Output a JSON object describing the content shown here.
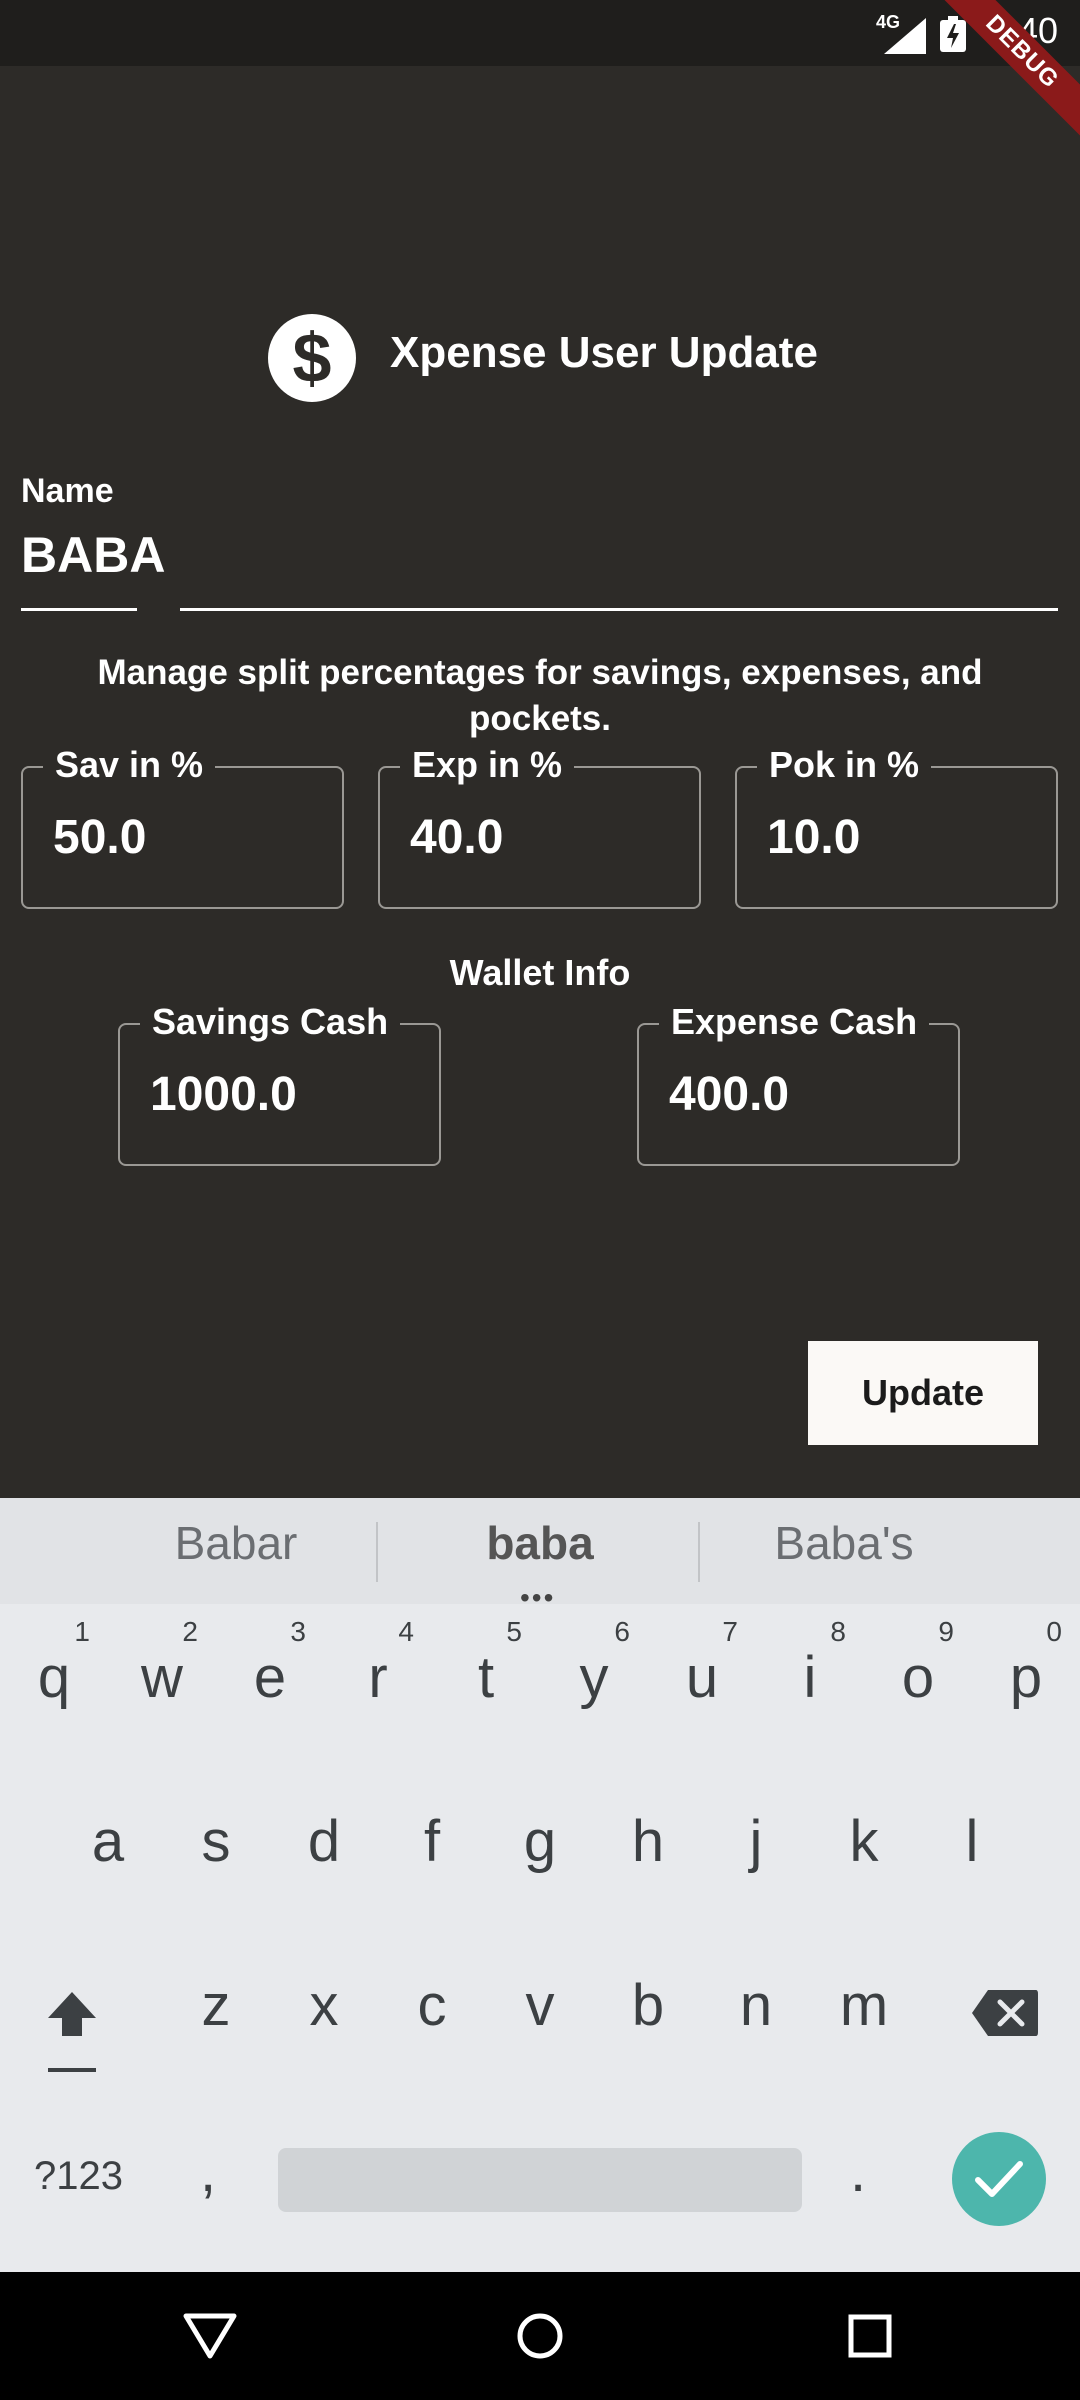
{
  "status_bar": {
    "time": "3:40",
    "network": "4G",
    "debug_banner": "DEBUG"
  },
  "header": {
    "logo_glyph": "$",
    "title": "Xpense User Update"
  },
  "name_field": {
    "label": "Name",
    "value": "BABA"
  },
  "split": {
    "description": "Manage split percentages for savings, expenses, and pockets.",
    "fields": [
      {
        "label": "Sav in %",
        "value": "50.0"
      },
      {
        "label": "Exp in %",
        "value": "40.0"
      },
      {
        "label": "Pok in %",
        "value": "10.0"
      }
    ]
  },
  "wallet": {
    "title": "Wallet Info",
    "fields": [
      {
        "label": "Savings Cash",
        "value": "1000.0"
      },
      {
        "label": "Expense Cash",
        "value": "400.0"
      }
    ]
  },
  "update_button": {
    "label": "Update"
  },
  "keyboard": {
    "suggestions": [
      "Babar",
      "baba",
      "Baba's"
    ],
    "row1": [
      {
        "key": "q",
        "hint": "1"
      },
      {
        "key": "w",
        "hint": "2"
      },
      {
        "key": "e",
        "hint": "3"
      },
      {
        "key": "r",
        "hint": "4"
      },
      {
        "key": "t",
        "hint": "5"
      },
      {
        "key": "y",
        "hint": "6"
      },
      {
        "key": "u",
        "hint": "7"
      },
      {
        "key": "i",
        "hint": "8"
      },
      {
        "key": "o",
        "hint": "9"
      },
      {
        "key": "p",
        "hint": "0"
      }
    ],
    "row2": [
      "a",
      "s",
      "d",
      "f",
      "g",
      "h",
      "j",
      "k",
      "l"
    ],
    "row3": [
      "z",
      "x",
      "c",
      "v",
      "b",
      "n",
      "m"
    ],
    "symbols_label": "?123",
    "comma": ",",
    "period": "."
  },
  "colors": {
    "background": "#2d2b28",
    "accent": "#4db6ac",
    "debug": "#8b1a1a"
  },
  "icons": [
    "dollar-icon",
    "signal-icon",
    "battery-icon",
    "shift-icon",
    "backspace-icon",
    "check-icon",
    "back-icon",
    "home-icon",
    "recents-icon"
  ]
}
